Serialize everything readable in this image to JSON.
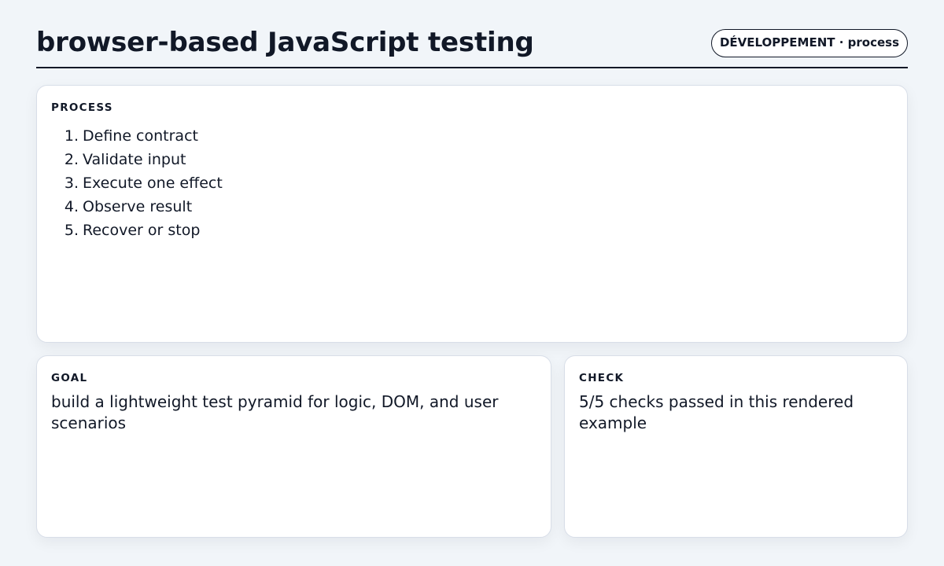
{
  "header": {
    "title": "browser-based JavaScript testing",
    "badge": "DÉVELOPPEMENT · process"
  },
  "process": {
    "label": "PROCESS",
    "steps": [
      {
        "num": "1.",
        "text": "Define contract"
      },
      {
        "num": "2.",
        "text": "Validate input"
      },
      {
        "num": "3.",
        "text": "Execute one effect"
      },
      {
        "num": "4.",
        "text": "Observe result"
      },
      {
        "num": "5.",
        "text": "Recover or stop"
      }
    ]
  },
  "goal": {
    "label": "GOAL",
    "text": "build a lightweight test pyramid for logic, DOM, and user scenarios"
  },
  "check": {
    "label": "CHECK",
    "text": "5/5 checks passed in this rendered example"
  }
}
